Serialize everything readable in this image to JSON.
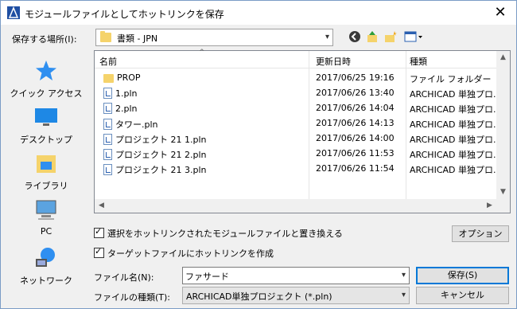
{
  "window": {
    "title": "モジュールファイルとしてホットリンクを保存",
    "close_glyph": "✕"
  },
  "location": {
    "label": "保存する場所(I):",
    "value": "書類 - JPN",
    "toolbar_icons": [
      "back-icon",
      "up-folder-icon",
      "new-folder-icon",
      "view-menu-icon"
    ]
  },
  "places": [
    {
      "label": "クイック アクセス",
      "icon": "star-icon"
    },
    {
      "label": "デスクトップ",
      "icon": "desktop-icon"
    },
    {
      "label": "ライブラリ",
      "icon": "library-icon"
    },
    {
      "label": "PC",
      "icon": "computer-icon"
    },
    {
      "label": "ネットワーク",
      "icon": "network-icon"
    }
  ],
  "list": {
    "columns": [
      "名前",
      "更新日時",
      "種類"
    ],
    "rows": [
      {
        "name": "PROP",
        "date": "2017/06/25 19:16",
        "type": "ファイル フォルダー",
        "icon": "folder"
      },
      {
        "name": "1.pln",
        "date": "2017/06/26 13:40",
        "type": "ARCHICAD 単独プロ...",
        "icon": "doc"
      },
      {
        "name": "2.pln",
        "date": "2017/06/26 14:04",
        "type": "ARCHICAD 単独プロ...",
        "icon": "doc"
      },
      {
        "name": "タワー.pln",
        "date": "2017/06/26 14:13",
        "type": "ARCHICAD 単独プロ...",
        "icon": "doc"
      },
      {
        "name": "プロジェクト 21 1.pln",
        "date": "2017/06/26 14:00",
        "type": "ARCHICAD 単独プロ...",
        "icon": "doc"
      },
      {
        "name": "プロジェクト 21 2.pln",
        "date": "2017/06/26 11:53",
        "type": "ARCHICAD 単独プロ...",
        "icon": "doc"
      },
      {
        "name": "プロジェクト 21 3.pln",
        "date": "2017/06/26 11:54",
        "type": "ARCHICAD 単独プロ...",
        "icon": "doc"
      }
    ]
  },
  "options": {
    "replace_label": "選択をホットリンクされたモジュールファイルと置き換える",
    "replace_checked": true,
    "create_label": "ターゲットファイルにホットリンクを作成",
    "create_checked": true,
    "options_button": "オプション"
  },
  "filename": {
    "label": "ファイル名(N):",
    "value": "ファサード"
  },
  "filetype": {
    "label": "ファイルの種類(T):",
    "value": "ARCHICAD単独プロジェクト (*.pln)"
  },
  "buttons": {
    "save": "保存(S)",
    "cancel": "キャンセル"
  },
  "colors": {
    "accent": "#0078d7",
    "folder": "#f5d36b",
    "star": "#2f8ff0"
  }
}
